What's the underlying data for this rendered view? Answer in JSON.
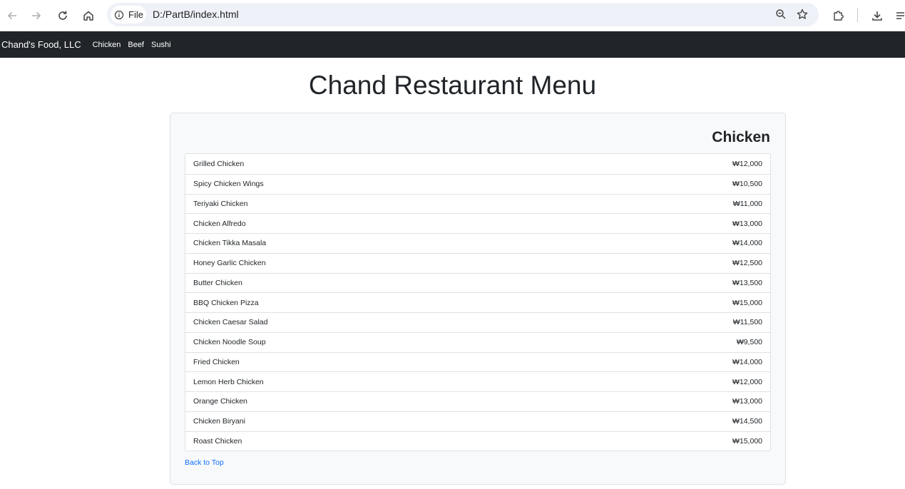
{
  "browser": {
    "file_label": "File",
    "url": "D:/PartB/index.html"
  },
  "navbar": {
    "brand": "Chand's Food, LLC",
    "links": [
      "Chicken",
      "Beef",
      "Sushi"
    ]
  },
  "page": {
    "title": "Chand Restaurant Menu",
    "section_heading": "Chicken",
    "back_to_top": "Back to Top"
  },
  "menu_items": [
    {
      "name": "Grilled Chicken",
      "price": "₩12,000"
    },
    {
      "name": "Spicy Chicken Wings",
      "price": "₩10,500"
    },
    {
      "name": "Teriyaki Chicken",
      "price": "₩11,000"
    },
    {
      "name": "Chicken Alfredo",
      "price": "₩13,000"
    },
    {
      "name": "Chicken Tikka Masala",
      "price": "₩14,000"
    },
    {
      "name": "Honey Garlic Chicken",
      "price": "₩12,500"
    },
    {
      "name": "Butter Chicken",
      "price": "₩13,500"
    },
    {
      "name": "BBQ Chicken Pizza",
      "price": "₩15,000"
    },
    {
      "name": "Chicken Caesar Salad",
      "price": "₩11,500"
    },
    {
      "name": "Chicken Noodle Soup",
      "price": "₩9,500"
    },
    {
      "name": "Fried Chicken",
      "price": "₩14,000"
    },
    {
      "name": "Lemon Herb Chicken",
      "price": "₩12,000"
    },
    {
      "name": "Orange Chicken",
      "price": "₩13,000"
    },
    {
      "name": "Chicken Biryani",
      "price": "₩14,500"
    },
    {
      "name": "Roast Chicken",
      "price": "₩15,000"
    }
  ]
}
